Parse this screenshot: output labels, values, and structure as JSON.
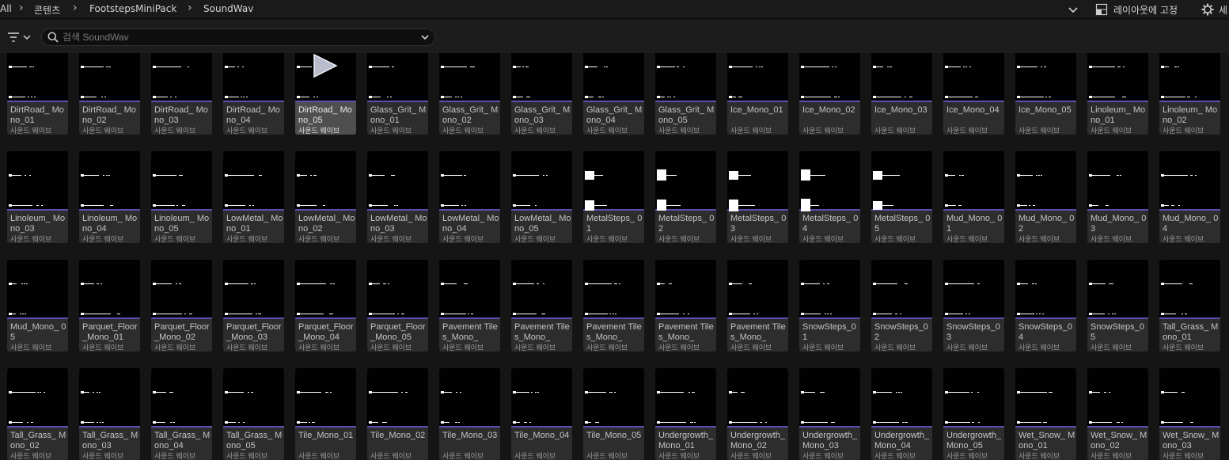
{
  "breadcrumb": {
    "items": [
      "All",
      "콘텐츠",
      "FootstepsMiniPack",
      "SoundWav"
    ]
  },
  "topbar": {
    "layout_lock_label": "레이아웃에 고정",
    "settings_label": "세"
  },
  "search": {
    "placeholder": "검색 SoundWav",
    "value": ""
  },
  "asset_type_label": "사운드 웨이브",
  "colors": {
    "accent_sound_wave": "#5d4fb0",
    "tile_bg": "#2d2d2d",
    "tile_selected_bg": "#4f4f4f"
  },
  "assets": [
    {
      "name": "DirtRoad_ Mono_01",
      "type": "사운드 웨이브"
    },
    {
      "name": "DirtRoad_ Mono_02",
      "type": "사운드 웨이브"
    },
    {
      "name": "DirtRoad_ Mono_03",
      "type": "사운드 웨이브"
    },
    {
      "name": "DirtRoad_ Mono_04",
      "type": "사운드 웨이브"
    },
    {
      "name": "DirtRoad_ Mono_05",
      "type": "사운드 웨이브",
      "selected": true,
      "icon": "play-icon"
    },
    {
      "name": "Glass_Grit_ Mono_01",
      "type": "사운드 웨이브"
    },
    {
      "name": "Glass_Grit_ Mono_02",
      "type": "사운드 웨이브"
    },
    {
      "name": "Glass_Grit_ Mono_03",
      "type": "사운드 웨이브"
    },
    {
      "name": "Glass_Grit_ Mono_04",
      "type": "사운드 웨이브"
    },
    {
      "name": "Glass_Grit_ Mono_05",
      "type": "사운드 웨이브"
    },
    {
      "name": "Ice_Mono_01",
      "type": "사운드 웨이브"
    },
    {
      "name": "Ice_Mono_02",
      "type": "사운드 웨이브"
    },
    {
      "name": "Ice_Mono_03",
      "type": "사운드 웨이브"
    },
    {
      "name": "Ice_Mono_04",
      "type": "사운드 웨이브"
    },
    {
      "name": "Ice_Mono_05",
      "type": "사운드 웨이브"
    },
    {
      "name": "Linoleum_ Mono_01",
      "type": "사운드 웨이브"
    },
    {
      "name": "Linoleum_ Mono_02",
      "type": "사운드 웨이브"
    },
    {
      "name": "Linoleum_ Mono_03",
      "type": "사운드 웨이브"
    },
    {
      "name": "Linoleum_ Mono_04",
      "type": "사운드 웨이브"
    },
    {
      "name": "Linoleum_ Mono_05",
      "type": "사운드 웨이브"
    },
    {
      "name": "LowMetal_ Mono_01",
      "type": "사운드 웨이브"
    },
    {
      "name": "LowMetal_ Mono_02",
      "type": "사운드 웨이브"
    },
    {
      "name": "LowMetal_ Mono_03",
      "type": "사운드 웨이브"
    },
    {
      "name": "LowMetal_ Mono_04",
      "type": "사운드 웨이브"
    },
    {
      "name": "LowMetal_ Mono_05",
      "type": "사운드 웨이브"
    },
    {
      "name": "MetalSteps_ 01",
      "type": "사운드 웨이브"
    },
    {
      "name": "MetalSteps_ 02",
      "type": "사운드 웨이브"
    },
    {
      "name": "MetalSteps_ 03",
      "type": "사운드 웨이브"
    },
    {
      "name": "MetalSteps_ 04",
      "type": "사운드 웨이브"
    },
    {
      "name": "MetalSteps_ 05",
      "type": "사운드 웨이브"
    },
    {
      "name": "Mud_Mono_ 01",
      "type": "사운드 웨이브"
    },
    {
      "name": "Mud_Mono_ 02",
      "type": "사운드 웨이브"
    },
    {
      "name": "Mud_Mono_ 03",
      "type": "사운드 웨이브"
    },
    {
      "name": "Mud_Mono_ 04",
      "type": "사운드 웨이브"
    },
    {
      "name": "Mud_Mono_ 05",
      "type": "사운드 웨이브"
    },
    {
      "name": "Parquet_Floor _Mono_01",
      "type": "사운드 웨이브"
    },
    {
      "name": "Parquet_Floor _Mono_02",
      "type": "사운드 웨이브"
    },
    {
      "name": "Parquet_Floor _Mono_03",
      "type": "사운드 웨이브"
    },
    {
      "name": "Parquet_Floor _Mono_04",
      "type": "사운드 웨이브"
    },
    {
      "name": "Parquet_Floor _Mono_05",
      "type": "사운드 웨이브"
    },
    {
      "name": "Pavement Tiles_Mono_",
      "type": "사운드 웨이브"
    },
    {
      "name": "Pavement Tiles_Mono_",
      "type": "사운드 웨이브"
    },
    {
      "name": "Pavement Tiles_Mono_",
      "type": "사운드 웨이브"
    },
    {
      "name": "Pavement Tiles_Mono_",
      "type": "사운드 웨이브"
    },
    {
      "name": "Pavement Tiles_Mono_",
      "type": "사운드 웨이브"
    },
    {
      "name": "SnowSteps_01",
      "type": "사운드 웨이브"
    },
    {
      "name": "SnowSteps_02",
      "type": "사운드 웨이브"
    },
    {
      "name": "SnowSteps_03",
      "type": "사운드 웨이브"
    },
    {
      "name": "SnowSteps_04",
      "type": "사운드 웨이브"
    },
    {
      "name": "SnowSteps_05",
      "type": "사운드 웨이브"
    },
    {
      "name": "Tall_Grass_ Mono_01",
      "type": "사운드 웨이브"
    },
    {
      "name": "Tall_Grass_ Mono_02",
      "type": "사운드 웨이브"
    },
    {
      "name": "Tall_Grass_ Mono_03",
      "type": "사운드 웨이브"
    },
    {
      "name": "Tall_Grass_ Mono_04",
      "type": "사운드 웨이브"
    },
    {
      "name": "Tall_Grass_ Mono_05",
      "type": "사운드 웨이브"
    },
    {
      "name": "Tile_Mono_01",
      "type": "사운드 웨이브"
    },
    {
      "name": "Tile_Mono_02",
      "type": "사운드 웨이브"
    },
    {
      "name": "Tile_Mono_03",
      "type": "사운드 웨이브"
    },
    {
      "name": "Tile_Mono_04",
      "type": "사운드 웨이브"
    },
    {
      "name": "Tile_Mono_05",
      "type": "사운드 웨이브"
    },
    {
      "name": "Undergrowth_ Mono_01",
      "type": "사운드 웨이브"
    },
    {
      "name": "Undergrowth_ Mono_02",
      "type": "사운드 웨이브"
    },
    {
      "name": "Undergrowth_ Mono_03",
      "type": "사운드 웨이브"
    },
    {
      "name": "Undergrowth_ Mono_04",
      "type": "사운드 웨이브"
    },
    {
      "name": "Undergrowth_ Mono_05",
      "type": "사운드 웨이브"
    },
    {
      "name": "Wet_Snow_ Mono_01",
      "type": "사운드 웨이브"
    },
    {
      "name": "Wet_Snow_ Mono_02",
      "type": "사운드 웨이브"
    },
    {
      "name": "Wet_Snow_ Mono_03",
      "type": "사운드 웨이브"
    }
  ]
}
